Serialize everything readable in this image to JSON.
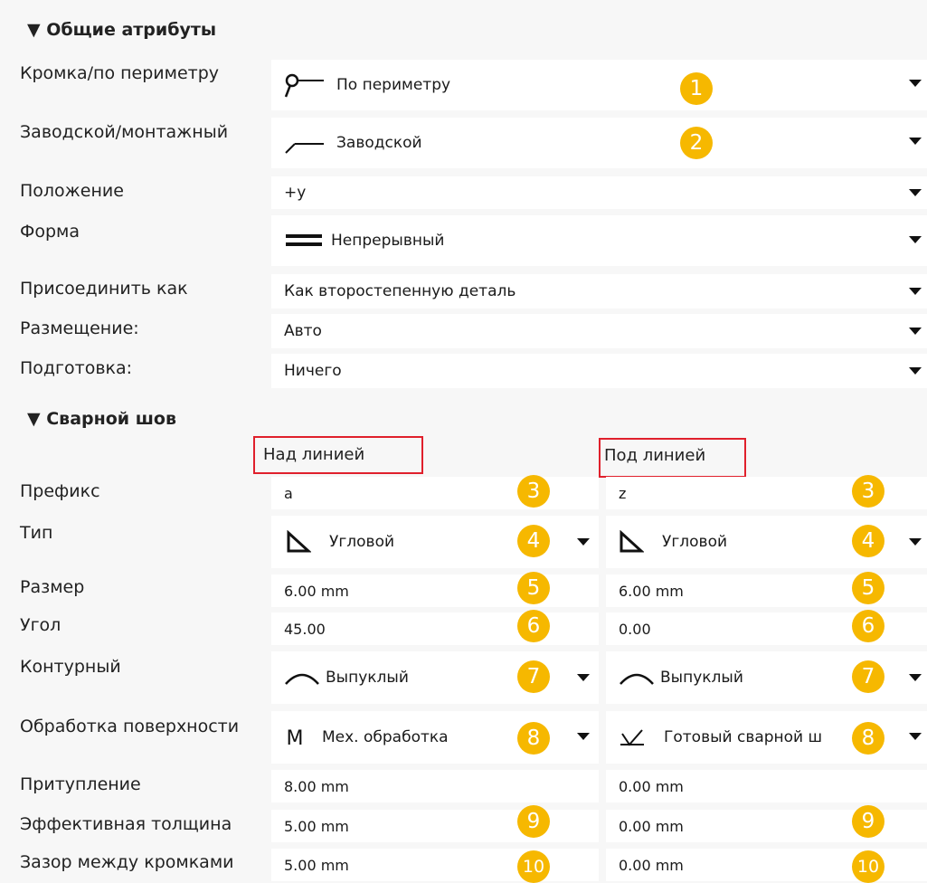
{
  "sections": {
    "general_title": "▼ Общие атрибуты",
    "weld_title": "▼ Сварной шов"
  },
  "general": [
    {
      "label": "Кромка/по периметру",
      "value": "По периметру",
      "badge": "1",
      "icon": "perimeter-icon"
    },
    {
      "label": "Заводской/монтажный",
      "value": "Заводской",
      "badge": "2",
      "icon": "workshop-icon"
    },
    {
      "label": "Положение",
      "value": "+y"
    },
    {
      "label": "Форма",
      "value": "Непрерывный",
      "icon": "continuous-line-icon"
    },
    {
      "label": "Присоединить как",
      "value": "Как второстепенную деталь"
    },
    {
      "label": "Размещение:",
      "value": "Авто"
    },
    {
      "label": "Подготовка:",
      "value": "Ничего"
    }
  ],
  "columns": {
    "above": "Над линией",
    "below": "Под линией"
  },
  "weld_rows": [
    {
      "label": "Префикс",
      "above": "a",
      "below": "z",
      "badge": "3"
    },
    {
      "label": "Тип",
      "above": "Угловой",
      "below": "Угловой",
      "badge": "4",
      "icon": "fillet-weld-icon"
    },
    {
      "label": "Размер",
      "above": "6.00 mm",
      "below": "6.00 mm",
      "badge": "5"
    },
    {
      "label": "Угол",
      "above": "45.00",
      "below": "0.00",
      "badge": "6"
    },
    {
      "label": "Контурный",
      "above": "Выпуклый",
      "below": "Выпуклый",
      "badge": "7",
      "icon": "convex-icon"
    },
    {
      "label": "Обработка поверхности",
      "above": "Мех. обработка",
      "below": "Готовый сварной ш",
      "badge": "8"
    },
    {
      "label": "Притупление",
      "above": "8.00 mm",
      "below": "0.00 mm"
    },
    {
      "label": "Эффективная толщина",
      "above": "5.00 mm",
      "below": "0.00 mm",
      "badge": "9"
    },
    {
      "label": "Зазор между кромками",
      "above": "5.00 mm",
      "below": "0.00 mm",
      "badge": "10"
    }
  ],
  "colors": {
    "badge": "#f6b800",
    "highlight_box": "#e0202c",
    "field_bg": "#ffffff",
    "panel_bg": "#f7f7f7"
  }
}
